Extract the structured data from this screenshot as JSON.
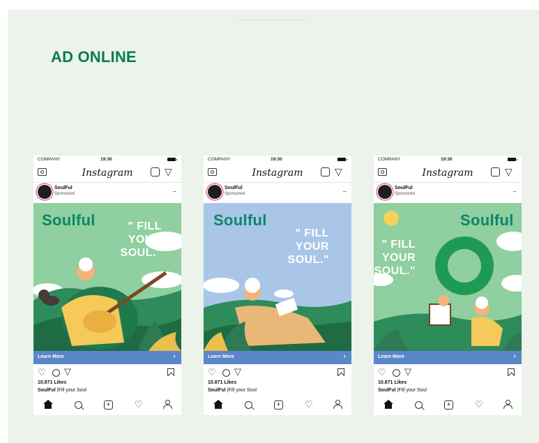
{
  "page": {
    "title": "AD ONLINE",
    "accent_color": "#0d7a56",
    "background_color": "#ebf3ea"
  },
  "posts": [
    {
      "status": {
        "carrier": "COMPANY",
        "time": "19:30"
      },
      "app_name": "Instagram",
      "account": "SoulFul",
      "sponsored": "Sponsored",
      "more": "...",
      "brand": "Soulful",
      "tagline": "\" FILL YOUR SOUL.\"",
      "image_color": "#8fcfa0",
      "cta": "Learn More",
      "likes": "10.871 Likes",
      "caption_user": "SoulFul",
      "caption_text": " |Fill your Soul"
    },
    {
      "status": {
        "carrier": "COMPANY",
        "time": "19:30"
      },
      "app_name": "Instagram",
      "account": "SoulFul",
      "sponsored": "Sponsored",
      "more": "...",
      "brand": "Soulful",
      "tagline": "\" FILL YOUR SOUL.\"",
      "image_color": "#a9c6e8",
      "cta": "Learn More",
      "likes": "10.871 Likes",
      "caption_user": "SoulFul",
      "caption_text": " |Fill your Soul"
    },
    {
      "status": {
        "carrier": "COMPANY",
        "time": "19:30"
      },
      "app_name": "Instagram",
      "account": "SoulFul",
      "sponsored": "Sponsored",
      "more": "...",
      "brand": "Soulful",
      "tagline": "\" FILL YOUR SOUL.\"",
      "image_color": "#8fcfa0",
      "cta": "Learn More",
      "likes": "10.871 Likes",
      "caption_user": "SoulFul",
      "caption_text": " |Fill your Soul"
    }
  ],
  "icons": {
    "direct": "▽",
    "heart": "♡",
    "share": "▽",
    "chevron": "›",
    "add": "+",
    "activity": "♡"
  }
}
